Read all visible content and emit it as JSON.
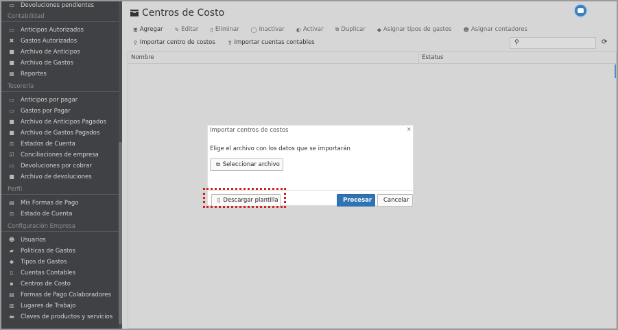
{
  "sidebar": {
    "top_item": {
      "label": "Devoluciones pendientes",
      "icon": "money-icon"
    },
    "sections": [
      {
        "title": "Contabilidad",
        "items": [
          {
            "label": "Anticipos Autorizados",
            "icon": "money-icon"
          },
          {
            "label": "Gastos Autorizados",
            "icon": "wrench-icon"
          },
          {
            "label": "Archivo de Anticipos",
            "icon": "file-icon"
          },
          {
            "label": "Archivo de Gastos",
            "icon": "file-icon"
          },
          {
            "label": "Reportes",
            "icon": "table-icon"
          }
        ]
      },
      {
        "title": "Tesorería",
        "items": [
          {
            "label": "Anticipos por pagar",
            "icon": "money-icon"
          },
          {
            "label": "Gastos por Pagar",
            "icon": "money-icon"
          },
          {
            "label": "Archivo de Anticipos Pagados",
            "icon": "file-icon"
          },
          {
            "label": "Archivo de Gastos Pagados",
            "icon": "file-icon"
          },
          {
            "label": "Estados de Cuenta",
            "icon": "balance-icon"
          },
          {
            "label": "Conciliaciones de empresa",
            "icon": "check-icon"
          },
          {
            "label": "Devoluciones por cobrar",
            "icon": "money-icon"
          },
          {
            "label": "Archivo de devoluciones",
            "icon": "file-icon"
          }
        ]
      },
      {
        "title": "Perfil",
        "items": [
          {
            "label": "Mis Formas de Pago",
            "icon": "card-icon"
          },
          {
            "label": "Estado de Cuenta",
            "icon": "balance-icon"
          }
        ]
      },
      {
        "title": "Configuración Empresa",
        "items": [
          {
            "label": "Usuarios",
            "icon": "users-icon"
          },
          {
            "label": "Politicas de Gastos",
            "icon": "book-icon"
          },
          {
            "label": "Tipos de Gastos",
            "icon": "tags-icon"
          },
          {
            "label": "Cuentas Contables",
            "icon": "book-icon"
          },
          {
            "label": "Centros de Costo",
            "icon": "archive-icon"
          },
          {
            "label": "Formas de Pago Colaboradores",
            "icon": "card-icon"
          },
          {
            "label": "Lugares de Trabajo",
            "icon": "building-icon"
          },
          {
            "label": "Claves de productos y servicios",
            "icon": "archive-icon"
          }
        ]
      }
    ]
  },
  "page": {
    "title": "Centros de Costo"
  },
  "toolbar": {
    "buttons": [
      {
        "label": "Agregar",
        "icon": "plus-icon",
        "enabled": true
      },
      {
        "label": "Editar",
        "icon": "edit-icon",
        "enabled": false
      },
      {
        "label": "Eliminar",
        "icon": "trash-icon",
        "enabled": false
      },
      {
        "label": "Inactivar",
        "icon": "toggle-off-icon",
        "enabled": false
      },
      {
        "label": "Activar",
        "icon": "toggle-on-icon",
        "enabled": false
      },
      {
        "label": "Duplicar",
        "icon": "copy-icon",
        "enabled": false
      },
      {
        "label": "Asignar tipos de gastos",
        "icon": "tags-icon",
        "enabled": false
      },
      {
        "label": "Asignar contadores",
        "icon": "users-icon",
        "enabled": false
      }
    ],
    "import_buttons": [
      {
        "label": "Importar centro de costos",
        "icon": "upload-icon"
      },
      {
        "label": "Importar cuentas contables",
        "icon": "upload-icon"
      }
    ]
  },
  "grid": {
    "columns": [
      "Nombre",
      "Estatus"
    ]
  },
  "modal": {
    "title": "Importar centros de costos",
    "message": "Elige el archivo con los datos que se importarán",
    "select_label": "Seleccionar archivo",
    "download_label": "Descargar plantilla",
    "process_label": "Procesar",
    "cancel_label": "Cancelar"
  },
  "colors": {
    "primary": "#2e74b5",
    "sidebar": "#3f4144",
    "highlight": "#d02020"
  }
}
